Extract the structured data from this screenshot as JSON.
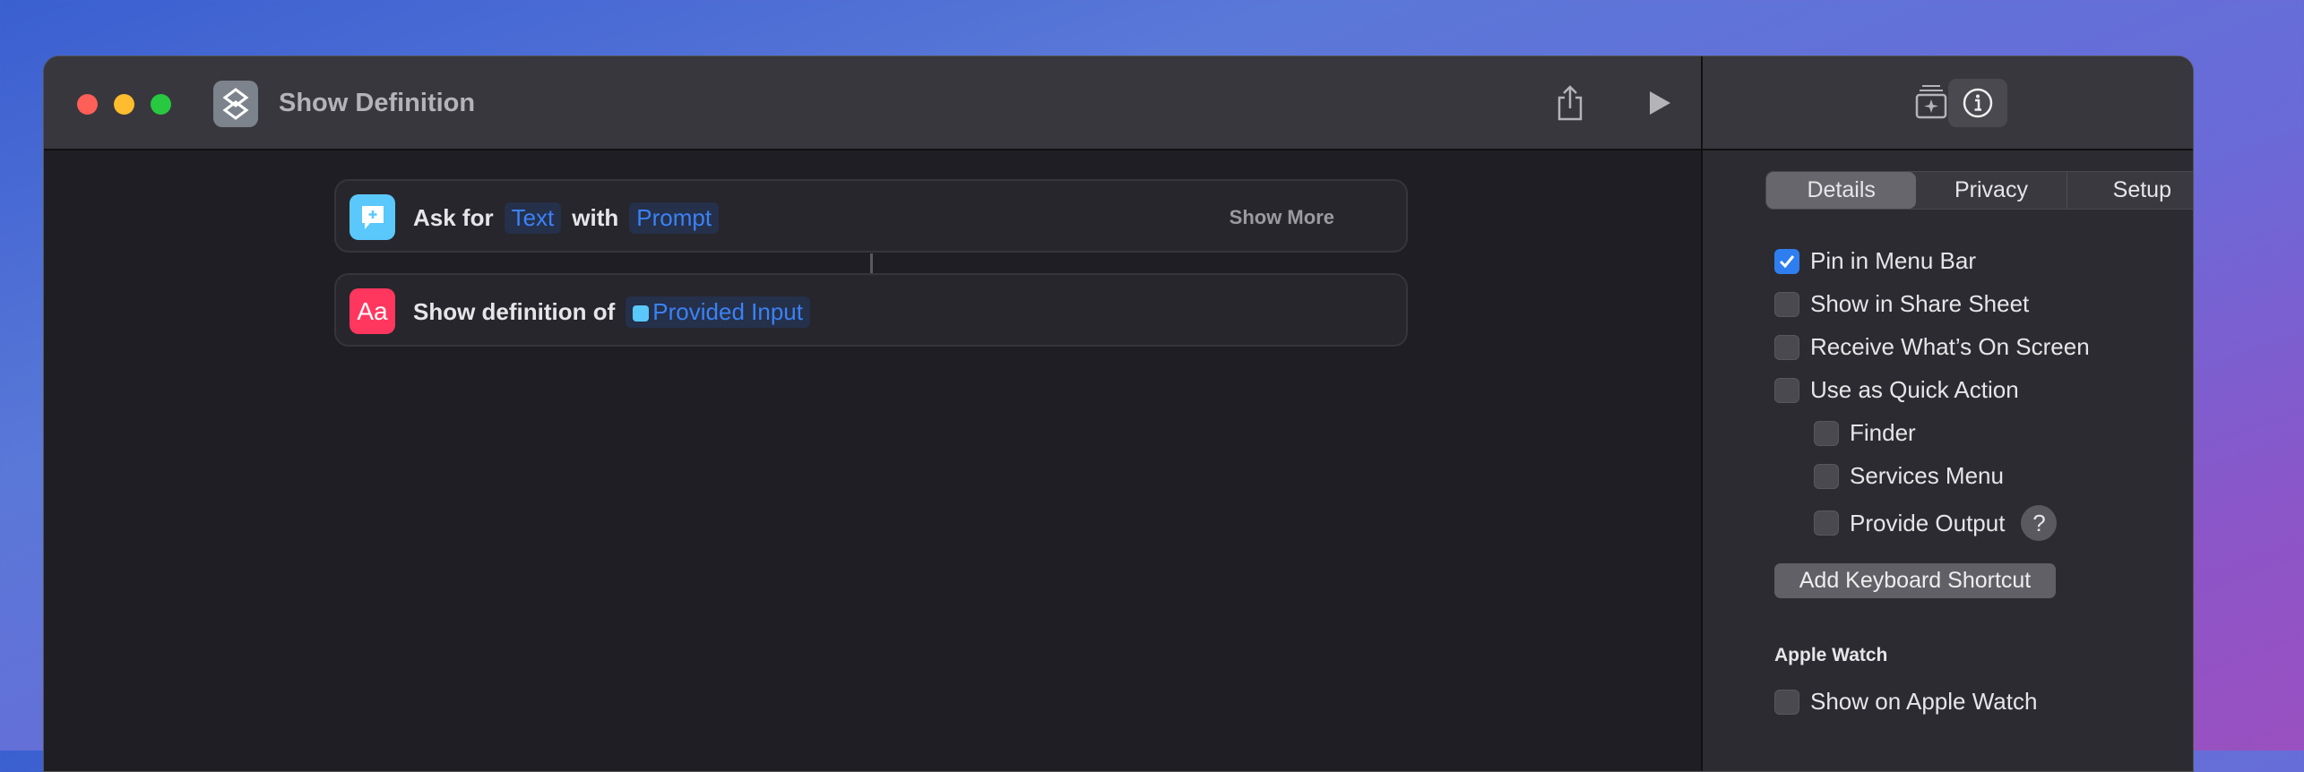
{
  "window": {
    "title": "Show Definition"
  },
  "actions": [
    {
      "parts": [
        "Ask for",
        "Text",
        "with",
        "Prompt"
      ],
      "show_more": "Show More",
      "icon": "ask-text-icon",
      "color": "#5ac8fa"
    },
    {
      "parts": [
        "Show definition of",
        "Provided Input"
      ],
      "icon": "dictionary-icon",
      "icon_text": "Aa",
      "color": "#ff375f"
    }
  ],
  "sidebar": {
    "tabs": [
      "Details",
      "Privacy",
      "Setup"
    ],
    "options": [
      {
        "label": "Pin in Menu Bar",
        "checked": true
      },
      {
        "label": "Show in Share Sheet",
        "checked": false
      },
      {
        "label": "Receive What’s On Screen",
        "checked": false
      },
      {
        "label": "Use as Quick Action",
        "checked": false
      },
      {
        "label": "Finder",
        "checked": false
      },
      {
        "label": "Services Menu",
        "checked": false
      },
      {
        "label": "Provide Output",
        "checked": false
      }
    ],
    "help": "?",
    "shortcut_button": "Add Keyboard Shortcut",
    "watch_header": "Apple Watch",
    "watch_option": {
      "label": "Show on Apple Watch",
      "checked": false
    }
  },
  "colors": {
    "accent": "#2f7ef0",
    "token": "#3b82f6"
  }
}
